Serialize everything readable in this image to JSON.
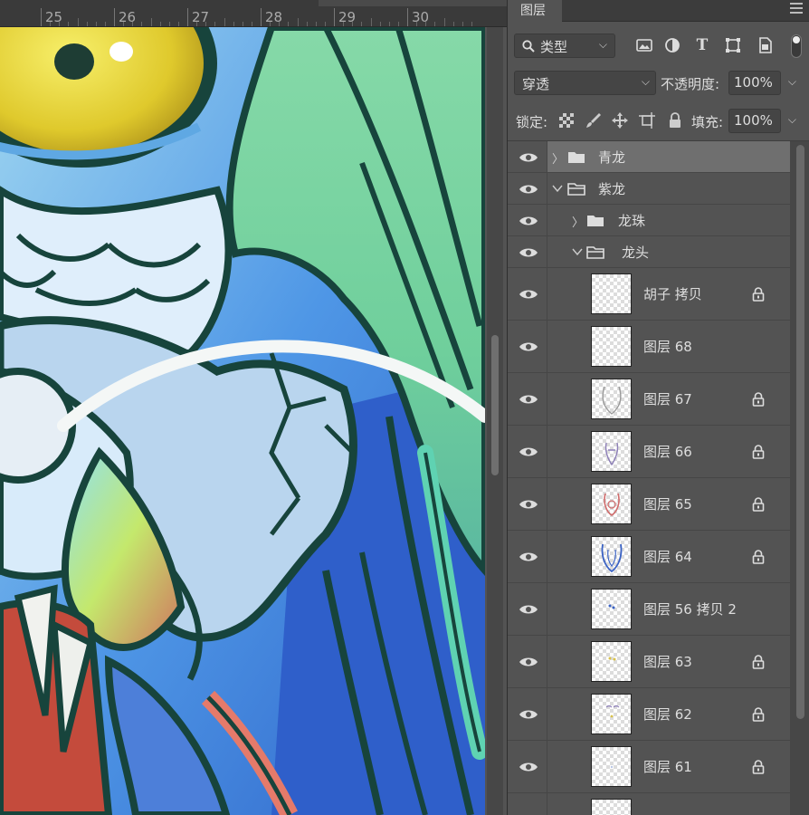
{
  "ruler": {
    "labels": [
      "25",
      "26",
      "27",
      "28",
      "29",
      "30"
    ]
  },
  "panel": {
    "tab_label": "图层",
    "filter": {
      "label": "类型",
      "icons": [
        "image-filter-icon",
        "adjustment-filter-icon",
        "type-filter-icon",
        "shape-filter-icon",
        "smart-object-filter-icon"
      ]
    },
    "blend_mode": "穿透",
    "opacity_label": "不透明度:",
    "opacity_value": "100%",
    "lock_label": "锁定:",
    "fill_label": "填充:",
    "fill_value": "100%"
  },
  "layers": [
    {
      "type": "group",
      "name": "青龙",
      "indent": 0,
      "expanded": false,
      "selected": true
    },
    {
      "type": "group",
      "name": "紫龙",
      "indent": 0,
      "expanded": true,
      "selected": false
    },
    {
      "type": "group",
      "name": "龙珠",
      "indent": 1,
      "expanded": false,
      "selected": false
    },
    {
      "type": "group",
      "name": "龙头",
      "indent": 1,
      "expanded": true,
      "selected": false
    },
    {
      "type": "layer",
      "name": "胡子 拷贝",
      "locked": true,
      "thumb": "empty"
    },
    {
      "type": "layer",
      "name": "图层 68",
      "locked": false,
      "thumb": "empty"
    },
    {
      "type": "layer",
      "name": "图层 67",
      "locked": true,
      "thumb": "scribble-gray"
    },
    {
      "type": "layer",
      "name": "图层 66",
      "locked": true,
      "thumb": "scribble-purple"
    },
    {
      "type": "layer",
      "name": "图层 65",
      "locked": true,
      "thumb": "scribble-red"
    },
    {
      "type": "layer",
      "name": "图层 64",
      "locked": true,
      "thumb": "scribble-blue"
    },
    {
      "type": "layer",
      "name": "图层 56 拷贝 2",
      "locked": false,
      "thumb": "dots-blue"
    },
    {
      "type": "layer",
      "name": "图层 63",
      "locked": true,
      "thumb": "dots-yellow"
    },
    {
      "type": "layer",
      "name": "图层 62",
      "locked": true,
      "thumb": "dots-purple"
    },
    {
      "type": "layer",
      "name": "图层 61",
      "locked": true,
      "thumb": "dots-faint"
    }
  ],
  "colors": {
    "panel_bg": "#535353",
    "selected_row": "#6f6f6f",
    "outline": "#17443c"
  }
}
